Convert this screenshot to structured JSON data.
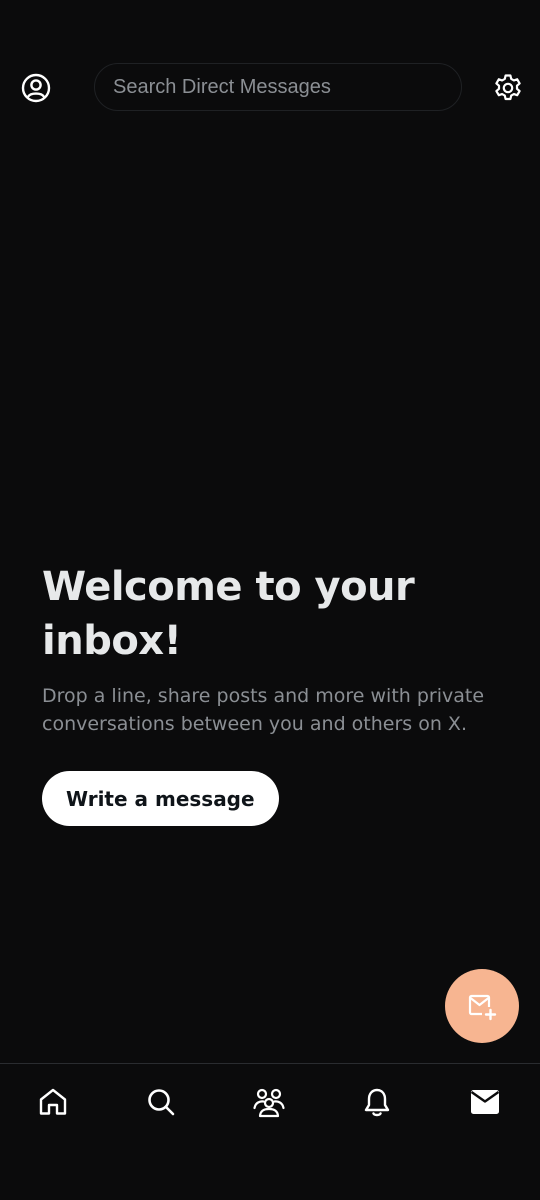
{
  "header": {
    "search_placeholder": "Search Direct Messages",
    "profile_icon": "profile-icon",
    "settings_icon": "gear-icon"
  },
  "welcome": {
    "title": "Welcome to your inbox!",
    "subtitle": "Drop a line, share posts and more with private conversations between you and others on X.",
    "button_label": "Write a message"
  },
  "fab": {
    "icon": "new-message-icon",
    "color": "#f7b591"
  },
  "bottom_nav": {
    "items": [
      {
        "icon": "home-icon",
        "active": false
      },
      {
        "icon": "search-icon",
        "active": false
      },
      {
        "icon": "communities-icon",
        "active": false
      },
      {
        "icon": "bell-icon",
        "active": false
      },
      {
        "icon": "mail-icon",
        "active": true
      }
    ]
  },
  "colors": {
    "background": "#0b0b0c",
    "text_primary": "#e7e9ea",
    "text_secondary": "#8b8f94",
    "accent": "#f7b591"
  }
}
